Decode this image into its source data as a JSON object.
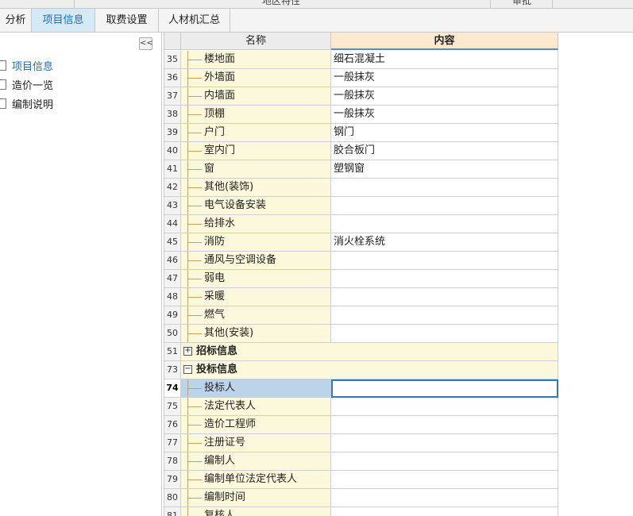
{
  "top_strip": {
    "left_text": "地区特性",
    "right_text": "审批"
  },
  "tabs": [
    {
      "label": "分析",
      "active": false
    },
    {
      "label": "项目信息",
      "active": true
    },
    {
      "label": "取费设置",
      "active": false
    },
    {
      "label": "人材机汇总",
      "active": false
    }
  ],
  "left_panel": {
    "collapse_label": "<<",
    "items": [
      {
        "label": "项目信息",
        "active": true
      },
      {
        "label": "造价一览",
        "active": false
      },
      {
        "label": "编制说明",
        "active": false
      }
    ]
  },
  "grid": {
    "headers": {
      "name": "名称",
      "content": "内容"
    },
    "rows": [
      {
        "num": "35",
        "name": "楼地面",
        "value": "细石混凝土"
      },
      {
        "num": "36",
        "name": "外墙面",
        "value": "一般抹灰"
      },
      {
        "num": "37",
        "name": "内墙面",
        "value": "一般抹灰"
      },
      {
        "num": "38",
        "name": "顶棚",
        "value": "一般抹灰"
      },
      {
        "num": "39",
        "name": "户门",
        "value": "钢门"
      },
      {
        "num": "40",
        "name": "室内门",
        "value": "胶合板门"
      },
      {
        "num": "41",
        "name": "窗",
        "value": "塑钢窗"
      },
      {
        "num": "42",
        "name": "其他(装饰)",
        "value": ""
      },
      {
        "num": "43",
        "name": "电气设备安装",
        "value": ""
      },
      {
        "num": "44",
        "name": "给排水",
        "value": ""
      },
      {
        "num": "45",
        "name": "消防",
        "value": "消火栓系统"
      },
      {
        "num": "46",
        "name": "通风与空调设备",
        "value": ""
      },
      {
        "num": "47",
        "name": "弱电",
        "value": ""
      },
      {
        "num": "48",
        "name": "采暖",
        "value": ""
      },
      {
        "num": "49",
        "name": "燃气",
        "value": ""
      },
      {
        "num": "50",
        "name": "其他(安装)",
        "value": ""
      },
      {
        "num": "51",
        "name": "招标信息",
        "value": "",
        "group": true,
        "expander": "+"
      },
      {
        "num": "73",
        "name": "投标信息",
        "value": "",
        "group": true,
        "expander": "−"
      },
      {
        "num": "74",
        "name": "投标人",
        "value": "",
        "selected": true
      },
      {
        "num": "75",
        "name": "法定代表人",
        "value": ""
      },
      {
        "num": "76",
        "name": "造价工程师",
        "value": ""
      },
      {
        "num": "77",
        "name": "注册证号",
        "value": ""
      },
      {
        "num": "78",
        "name": "编制人",
        "value": ""
      },
      {
        "num": "79",
        "name": "编制单位法定代表人",
        "value": ""
      },
      {
        "num": "80",
        "name": "编制时间",
        "value": ""
      },
      {
        "num": "81",
        "name": "复核人",
        "value": ""
      }
    ]
  },
  "colors": {
    "accent": "#1f6cb0",
    "selection": "#2f76d0",
    "name_bg": "#fcf8dc",
    "header_content_bg": "#fde9cf"
  }
}
